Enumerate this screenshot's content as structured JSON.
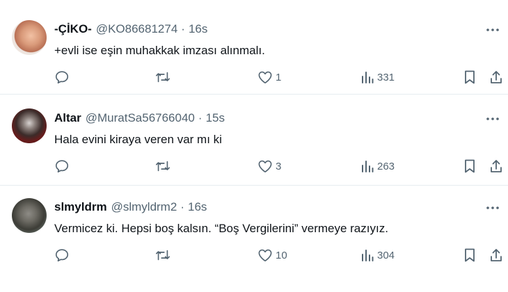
{
  "tweets": [
    {
      "name": "-ÇİKO-",
      "handle": "@KO86681274",
      "dot": "·",
      "time": "16s",
      "text": "+evli ise eşin muhakkak imzası alınmalı.",
      "likes": "1",
      "views": "331"
    },
    {
      "name": "Altar",
      "handle": "@MuratSa56766040",
      "dot": "·",
      "time": "15s",
      "text": "Hala evini kiraya veren var mı ki",
      "likes": "3",
      "views": "263"
    },
    {
      "name": "slmyldrm",
      "handle": "@slmyldrm2",
      "dot": "·",
      "time": "16s",
      "text": "Vermicez ki. Hepsi boş kalsın. “Boş Vergilerini” vermeye razıyız.",
      "likes": "10",
      "views": "304"
    }
  ],
  "icons": {
    "reply": "reply-icon",
    "retweet": "retweet-icon",
    "like": "heart-icon",
    "views": "views-icon",
    "bookmark": "bookmark-icon",
    "share": "share-icon",
    "more": "more-icon"
  },
  "colors": {
    "text": "#0f1419",
    "secondary": "#536471",
    "divider": "#e6ecf0"
  }
}
